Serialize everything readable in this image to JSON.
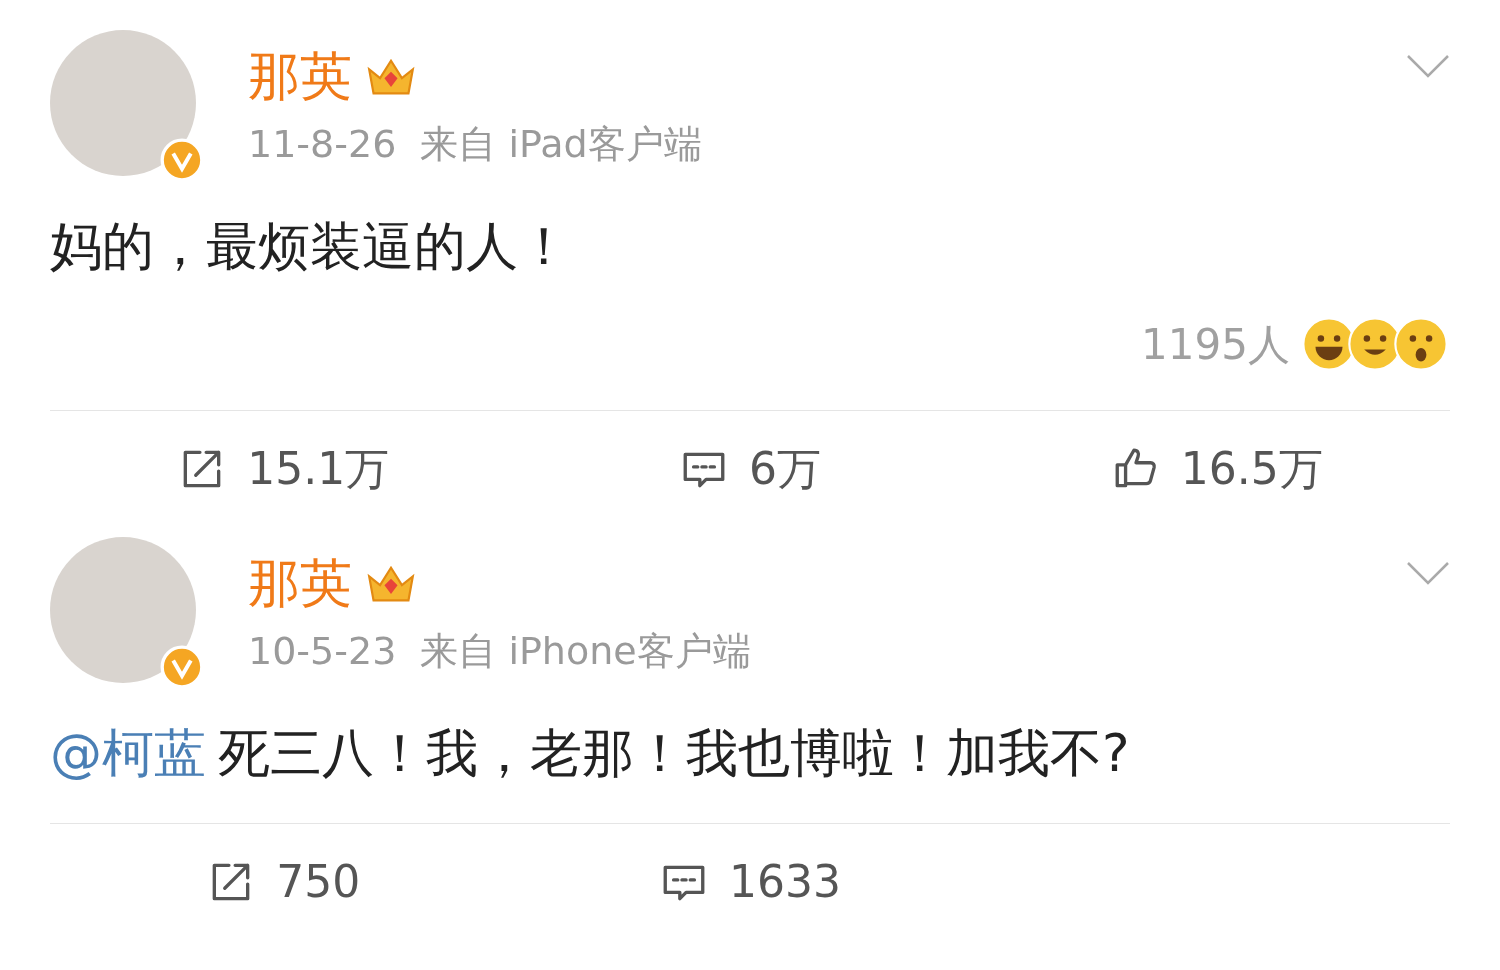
{
  "posts": [
    {
      "author": "那英",
      "verified": true,
      "date": "11-8-26",
      "source": "来自 iPad客户端",
      "body": "妈的，最烦装逼的人！",
      "reactions": {
        "count": "1195人"
      },
      "actions": [
        {
          "kind": "repost",
          "label": "15.1万"
        },
        {
          "kind": "comment",
          "label": "6万"
        },
        {
          "kind": "like",
          "label": "16.5万"
        }
      ]
    },
    {
      "author": "那英",
      "verified": true,
      "date": "10-5-23",
      "source": "来自 iPhone客户端",
      "mention": "@柯蓝",
      "body": "死三八！我，老那！我也博啦！加我不?",
      "actions": [
        {
          "kind": "repost",
          "label": "750"
        },
        {
          "kind": "comment",
          "label": "1633"
        }
      ]
    }
  ]
}
